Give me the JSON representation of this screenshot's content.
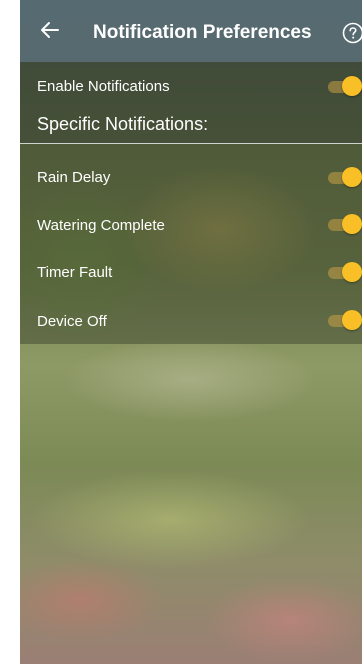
{
  "header": {
    "title": "Notification Preferences",
    "back_icon": "arrow-left-icon",
    "help_icon": "help-circle-icon"
  },
  "settings": {
    "enable_label": "Enable Notifications",
    "enable_on": true,
    "section_heading": "Specific Notifications:",
    "items": [
      {
        "label": "Rain Delay",
        "on": true
      },
      {
        "label": "Watering Complete",
        "on": true
      },
      {
        "label": "Timer Fault",
        "on": true
      },
      {
        "label": "Device Off",
        "on": true
      }
    ]
  },
  "colors": {
    "toggle_on": "#f9bf27",
    "header_bg": "#566a74"
  }
}
